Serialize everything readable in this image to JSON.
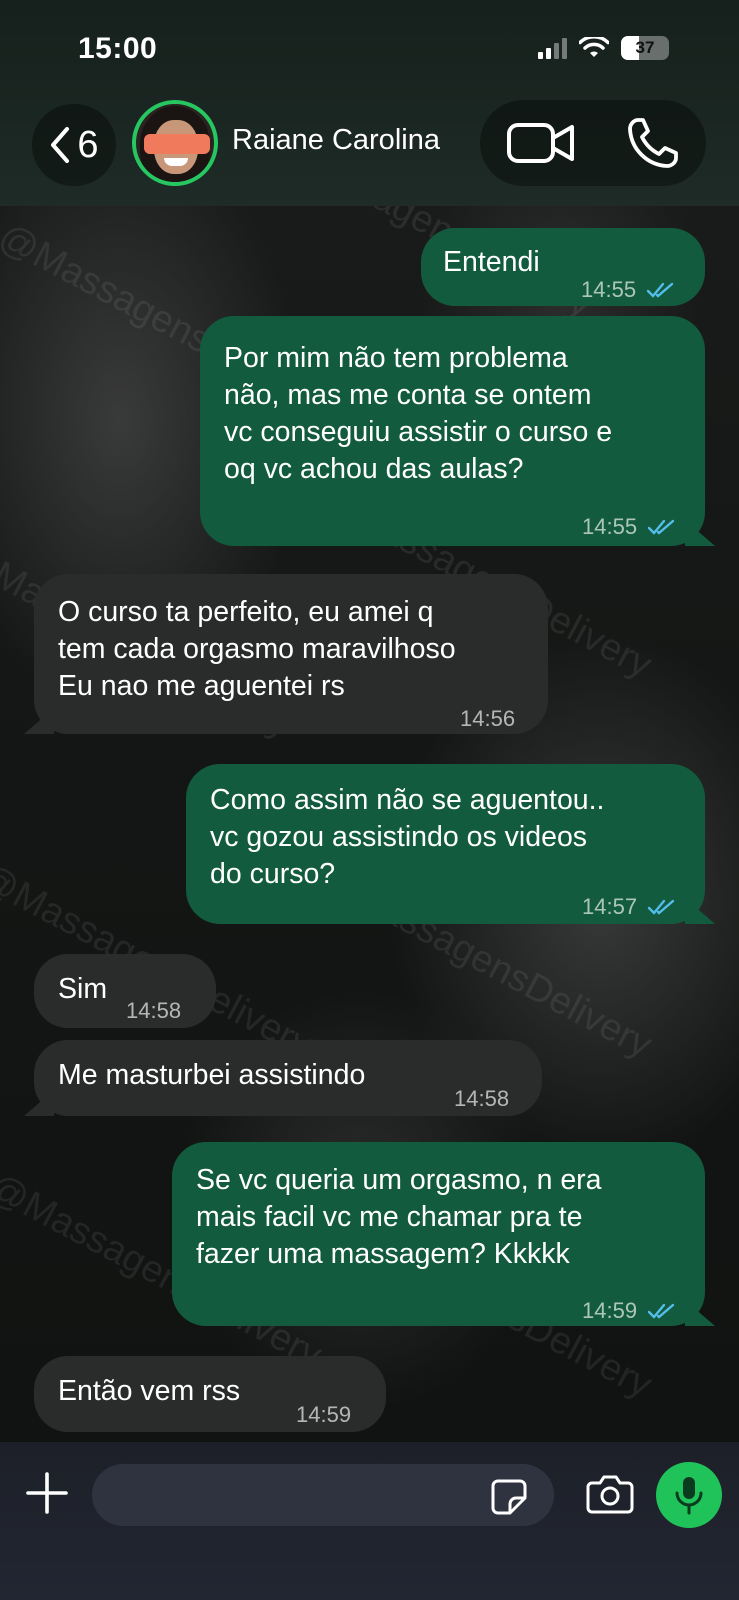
{
  "status_bar": {
    "time": "15:00",
    "battery": "37"
  },
  "header": {
    "back_count": "6",
    "contact_name": "Raiane Carolina"
  },
  "watermark": "@MassagensDelivery",
  "messages": [
    {
      "dir": "out",
      "text": "Entendi",
      "time": "14:55",
      "read": true
    },
    {
      "dir": "out",
      "text": "Por mim não tem problema\nnão, mas me conta se ontem\nvc conseguiu assistir o curso e\noq vc achou das aulas?",
      "time": "14:55",
      "read": true
    },
    {
      "dir": "in",
      "text": "O curso ta perfeito, eu amei q\ntem cada orgasmo maravilhoso\nEu nao me aguentei rs",
      "time": "14:56"
    },
    {
      "dir": "out",
      "text": "Como assim não se aguentou..\nvc gozou assistindo os videos\ndo curso?",
      "time": "14:57",
      "read": true
    },
    {
      "dir": "in",
      "text": "Sim",
      "time": "14:58"
    },
    {
      "dir": "in",
      "text": "Me masturbei assistindo",
      "time": "14:58"
    },
    {
      "dir": "out",
      "text": "Se vc queria um orgasmo, n era\nmais facil vc me chamar pra te\nfazer uma massagem? Kkkkk",
      "time": "14:59",
      "read": true
    },
    {
      "dir": "in",
      "text": "Então vem rss",
      "time": "14:59"
    }
  ],
  "colors": {
    "outgoing_bubble": "#135b3f",
    "incoming_bubble": "#2a2c2b",
    "accent_green": "#20c35a",
    "read_ticks": "#53bdeb"
  },
  "icons": [
    "back-chevron-icon",
    "video-call-icon",
    "phone-icon",
    "plus-icon",
    "sticker-icon",
    "camera-icon",
    "microphone-icon"
  ]
}
